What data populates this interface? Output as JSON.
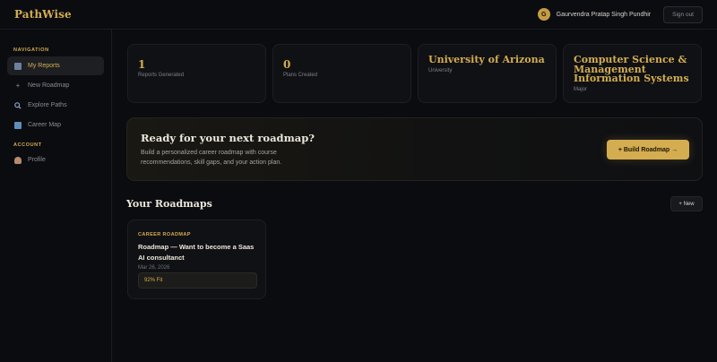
{
  "header": {
    "brand": "PathWise",
    "user_initial": "G",
    "user_name": "Gaurvendra Pratap Singh Pundhir",
    "signout_label": "Sign out"
  },
  "sidebar": {
    "navigation_label": "NAVIGATION",
    "account_label": "ACCOUNT",
    "items": [
      {
        "label": "My Reports",
        "icon": "report-icon",
        "active": true
      },
      {
        "label": "New Roadmap",
        "icon": "plus-icon",
        "active": false
      },
      {
        "label": "Explore Paths",
        "icon": "search-icon",
        "active": false
      },
      {
        "label": "Career Map",
        "icon": "map-icon",
        "active": false
      }
    ],
    "account_items": [
      {
        "label": "Profile",
        "icon": "user-icon"
      }
    ]
  },
  "stats": [
    {
      "value": "1",
      "label": "Reports Generated"
    },
    {
      "value": "0",
      "label": "Plans Created"
    },
    {
      "value": "University of Arizona",
      "label": "University"
    },
    {
      "value": "Computer Science & Management Information Systems",
      "label": "Major"
    }
  ],
  "hero": {
    "title": "Ready for your next roadmap?",
    "description": "Build a personalized career roadmap with course recommendations, skill gaps, and your action plan.",
    "button_label": "+ Build Roadmap →"
  },
  "roadmaps": {
    "title": "Your Roadmaps",
    "new_label": "+ New",
    "cards": [
      {
        "tag": "CAREER ROADMAP",
        "title": "Roadmap — Want to become a Saas AI consultanct",
        "date": "Mar 26, 2026",
        "fit": "92% Fit"
      }
    ]
  },
  "colors": {
    "accent": "#d4ad50",
    "background": "#0b0c10",
    "card": "#101115"
  }
}
